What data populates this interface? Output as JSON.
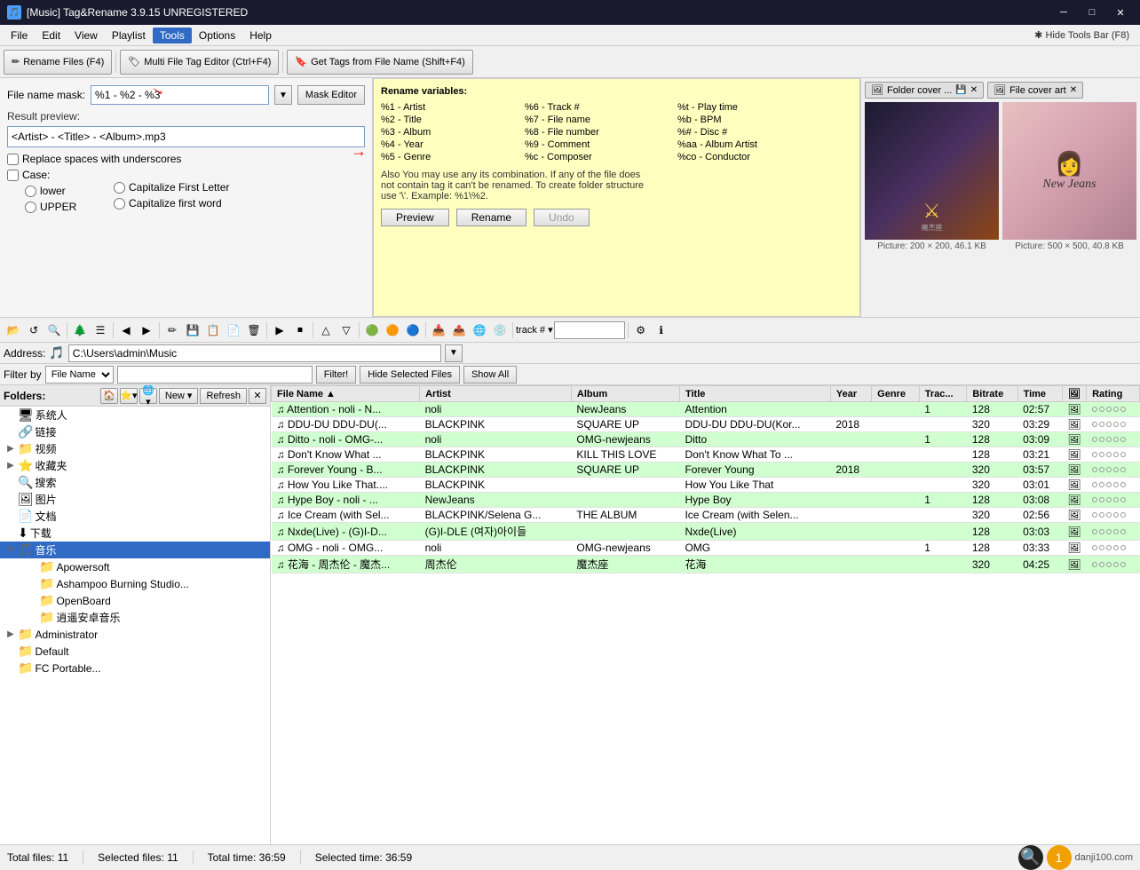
{
  "titleBar": {
    "icon": "🎵",
    "title": "[Music] Tag&Rename 3.9.15 UNREGISTERED",
    "minBtn": "─",
    "maxBtn": "□",
    "closeBtn": "✕"
  },
  "menuBar": {
    "items": [
      "File",
      "Edit",
      "View",
      "Playlist",
      "Tools",
      "Options",
      "Help"
    ],
    "activeIndex": 4,
    "hideTools": "✱ Hide Tools Bar (F8)"
  },
  "toolbar": {
    "renameFiles": "Rename Files (F4)",
    "multiTagEditor": "Multi File Tag Editor (Ctrl+F4)",
    "getTagsFromFile": "Get Tags from File Name (Shift+F4)"
  },
  "renamePanel": {
    "maskLabel": "File name mask:",
    "maskValue": "%1 - %2 - %3",
    "maskEditorBtn": "Mask Editor",
    "resultPreviewLabel": "Result preview:",
    "resultPreview": "<Artist> - <Title> - <Album>.mp3",
    "replaceSpaces": "Replace spaces with underscores",
    "caseLabel": "Case:",
    "caseOptions": [
      "lower",
      "UPPER"
    ],
    "capitalizeOptions": [
      "Capitalize First Letter",
      "Capitalize first word"
    ]
  },
  "renameVars": {
    "title": "Rename variables:",
    "vars": [
      [
        "%1 - Artist",
        "%6 - Track #",
        "%t - Play time"
      ],
      [
        "%2 - Title",
        "%7 - File name",
        "%b - BPM"
      ],
      [
        "%3 - Album",
        "%8 - File number",
        "%# - Disc #"
      ],
      [
        "%4 - Year",
        "%9 - Comment",
        "%aa - Album Artist"
      ],
      [
        "%5 - Genre",
        "%c - Composer",
        "%co - Conductor"
      ]
    ],
    "note": "Also You may use any its combination. If any of the file does\nnot contain tag it can't be renamed. To create folder structure\nuse '\\'. Example: %1\\%2.",
    "previewBtn": "Preview",
    "renameBtn": "Rename",
    "undoBtn": "Undo"
  },
  "albumArt": {
    "tab1": "Folder cover ...",
    "tab2": "File cover art",
    "img1": {
      "size": "Picture: 200 × 200, 46.1 KB"
    },
    "img2": {
      "size": "Picture: 500 × 500, 40.8 KB"
    }
  },
  "addressBar": {
    "label": "Address:",
    "path": "C:\\Users\\admin\\Music"
  },
  "filterBar": {
    "label": "Filter by",
    "filterType": "File Name",
    "filterBtn": "Filter!",
    "hideSelectedFiles": "Hide Selected Files",
    "showAll": "Show All"
  },
  "foldersPanel": {
    "label": "Folders:",
    "newBtn": "New ▾",
    "refreshBtn": "Refresh",
    "tree": [
      {
        "indent": 0,
        "icon": "🖥",
        "label": "系统人",
        "toggle": ""
      },
      {
        "indent": 0,
        "icon": "🔗",
        "label": "链接",
        "toggle": ""
      },
      {
        "indent": 0,
        "icon": "📁",
        "label": "视频",
        "toggle": "▶"
      },
      {
        "indent": 0,
        "icon": "⭐",
        "label": "收藏夹",
        "toggle": "▶"
      },
      {
        "indent": 0,
        "icon": "🔍",
        "label": "搜索",
        "toggle": ""
      },
      {
        "indent": 0,
        "icon": "🖼",
        "label": "图片",
        "toggle": ""
      },
      {
        "indent": 0,
        "icon": "📄",
        "label": "文档",
        "toggle": ""
      },
      {
        "indent": 0,
        "icon": "⬇",
        "label": "下载",
        "toggle": ""
      },
      {
        "indent": 0,
        "icon": "🎵",
        "label": "音乐",
        "toggle": "▼",
        "expanded": true
      },
      {
        "indent": 1,
        "icon": "📁",
        "label": "Apowersoft",
        "toggle": ""
      },
      {
        "indent": 1,
        "icon": "📁",
        "label": "Ashampoo Burning Studio...",
        "toggle": ""
      },
      {
        "indent": 1,
        "icon": "📁",
        "label": "OpenBoard",
        "toggle": ""
      },
      {
        "indent": 1,
        "icon": "📁",
        "label": "逍遥安卓音乐",
        "toggle": ""
      },
      {
        "indent": 0,
        "icon": "👤",
        "label": "Administrator",
        "toggle": "▶"
      },
      {
        "indent": 0,
        "icon": "👤",
        "label": "Default",
        "toggle": ""
      },
      {
        "indent": 0,
        "icon": "💿",
        "label": "FC Portable...",
        "toggle": ""
      }
    ]
  },
  "filesTable": {
    "columns": [
      "File Name",
      "Artist",
      "Album",
      "Title",
      "Year",
      "Genre",
      "Trac...",
      "Bitrate",
      "Time",
      "",
      "Rating"
    ],
    "rows": [
      {
        "fileName": "Attention - noli - N...",
        "artist": "noli",
        "album": "NewJeans",
        "title": "Attention",
        "year": "",
        "genre": "",
        "track": "1",
        "bitrate": "128",
        "time": "02:57",
        "bg": "green"
      },
      {
        "fileName": "DDU-DU DDU-DU(... ",
        "artist": "BLACKPINK",
        "album": "SQUARE UP",
        "title": "DDU-DU DDU-DU(Kor...",
        "year": "2018",
        "genre": "",
        "track": "",
        "bitrate": "320",
        "time": "03:29",
        "bg": "white"
      },
      {
        "fileName": "Ditto - noli - OMG-...",
        "artist": "noli",
        "album": "OMG-newjeans",
        "title": "Ditto",
        "year": "",
        "genre": "",
        "track": "1",
        "bitrate": "128",
        "time": "03:09",
        "bg": "green"
      },
      {
        "fileName": "Don't Know What ...",
        "artist": "BLACKPINK",
        "album": "KILL THIS LOVE",
        "title": "Don't Know What To ...",
        "year": "",
        "genre": "",
        "track": "",
        "bitrate": "128",
        "time": "03:21",
        "bg": "white"
      },
      {
        "fileName": "Forever Young - B...",
        "artist": "BLACKPINK",
        "album": "SQUARE UP",
        "title": "Forever Young",
        "year": "2018",
        "genre": "",
        "track": "",
        "bitrate": "320",
        "time": "03:57",
        "bg": "green"
      },
      {
        "fileName": "How You Like That....",
        "artist": "BLACKPINK",
        "album": "",
        "title": "How You Like That",
        "year": "",
        "genre": "",
        "track": "",
        "bitrate": "320",
        "time": "03:01",
        "bg": "white"
      },
      {
        "fileName": "Hype Boy - noli - ...",
        "artist": "NewJeans",
        "album": "",
        "title": "Hype Boy",
        "year": "",
        "genre": "",
        "track": "1",
        "bitrate": "128",
        "time": "03:08",
        "bg": "green"
      },
      {
        "fileName": "Ice Cream (with Sel...",
        "artist": "BLACKPINK/Selena G...",
        "album": "THE ALBUM",
        "title": "Ice Cream (with Selen...",
        "year": "",
        "genre": "",
        "track": "",
        "bitrate": "320",
        "time": "02:56",
        "bg": "white"
      },
      {
        "fileName": "Nxde(Live) - (G)I-D...",
        "artist": "(G)I-DLE (여자)아이들",
        "album": "",
        "title": "Nxde(Live)",
        "year": "",
        "genre": "",
        "track": "",
        "bitrate": "128",
        "time": "03:03",
        "bg": "green"
      },
      {
        "fileName": "OMG - noli - OMG...",
        "artist": "noli",
        "album": "OMG-newjeans",
        "title": "OMG",
        "year": "",
        "genre": "",
        "track": "1",
        "bitrate": "128",
        "time": "03:33",
        "bg": "white"
      },
      {
        "fileName": "花海 - 周杰伦 - 魔杰...",
        "artist": "周杰伦",
        "album": "魔杰座",
        "title": "花海",
        "year": "",
        "genre": "",
        "track": "",
        "bitrate": "320",
        "time": "04:25",
        "bg": "green"
      }
    ]
  },
  "statusBar": {
    "totalFiles": "Total files: 11",
    "selectedFiles": "Selected files: 11",
    "totalTime": "Total time: 36:59",
    "selectedTime": "Selected time: 36:59"
  },
  "watermark": "danji100.com",
  "icons": {
    "folder": "📁",
    "music": "🎵",
    "star": "⭐",
    "search": "🔍",
    "refresh": "↺",
    "new": "📄",
    "close": "✕",
    "arrowDown": "▼",
    "arrowRight": "▶"
  }
}
